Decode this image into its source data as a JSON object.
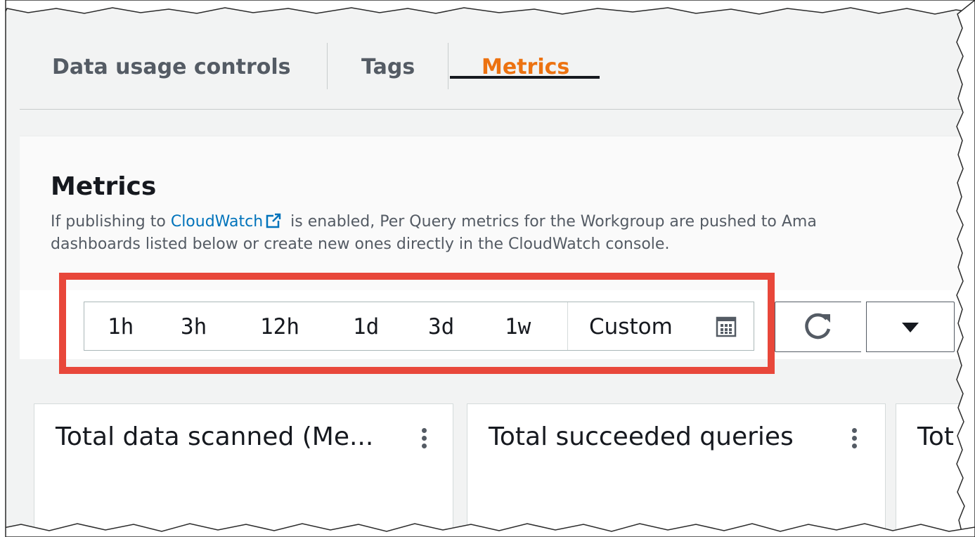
{
  "tabs": [
    {
      "label": "Data usage controls",
      "active": false
    },
    {
      "label": "Tags",
      "active": false
    },
    {
      "label": "Metrics",
      "active": true
    }
  ],
  "panel": {
    "title": "Metrics",
    "desc_line1_pre": "If publishing to ",
    "desc_link": "CloudWatch",
    "desc_line1_post": " is enabled, Per Query metrics for the Workgroup are pushed to Ama",
    "desc_line2": "dashboards listed below or create new ones directly in the CloudWatch console."
  },
  "time_range": {
    "options": [
      "1h",
      "3h",
      "12h",
      "1d",
      "3d",
      "1w"
    ],
    "custom_label": "Custom"
  },
  "widgets": [
    {
      "title": "Total data scanned (Me..."
    },
    {
      "title": "Total succeeded queries"
    },
    {
      "title": "Tot"
    }
  ],
  "icons": {
    "external_link": "external-link-icon",
    "calendar": "calendar-icon",
    "refresh": "refresh-icon",
    "dropdown": "caret-down-icon",
    "menu": "vertical-ellipsis-icon"
  },
  "colors": {
    "active_tab": "#ec7211",
    "link": "#0073bb",
    "highlight": "#e8473a"
  }
}
